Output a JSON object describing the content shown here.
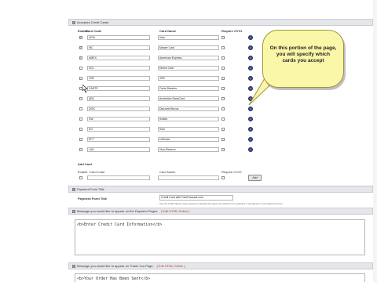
{
  "accepted_section": {
    "title": "Accepted Credit Cards"
  },
  "columns": {
    "enable": "Enable",
    "code": "Card Code",
    "name": "Card Name",
    "cvv": "Require CVV2"
  },
  "cards": [
    {
      "enabled": true,
      "code": "VISA",
      "name": "Visa"
    },
    {
      "enabled": true,
      "code": "MC",
      "name": "Master Card"
    },
    {
      "enabled": true,
      "code": "AMEX",
      "name": "American Express"
    },
    {
      "enabled": false,
      "code": "DCL",
      "name": "Diners Club"
    },
    {
      "enabled": false,
      "code": "JCB",
      "name": "JCB"
    },
    {
      "enabled": false,
      "code": "CARTE",
      "name": "Carte Blanche"
    },
    {
      "enabled": false,
      "code": "ABC",
      "name": "Australian BankCard"
    },
    {
      "enabled": false,
      "code": "DISC",
      "name": "Discover/Novus"
    },
    {
      "enabled": false,
      "code": "SW",
      "name": "Switch"
    },
    {
      "enabled": false,
      "code": "SO",
      "name": "Solo"
    },
    {
      "enabled": false,
      "code": "EFT",
      "name": "enRoute"
    },
    {
      "enabled": false,
      "code": "LAS",
      "name": "Visa Electron"
    }
  ],
  "add_card": {
    "title": "Add Card",
    "enable_label": "Enable",
    "code_label": "Card Code",
    "name_label": "Card Name",
    "cvv_label": "Require CVV2",
    "add_button": "Add"
  },
  "payment_form": {
    "section_title": "Payment Form Title",
    "label": "Payment Form Title",
    "value": "Credit Card with FastTransact.com",
    "help": "Use the HTML field to help customers identify this payment method if it is selected. It will appear on the Payment Form."
  },
  "payment_message": {
    "title": "Message you would like to appear on the Payment Pages:",
    "link": "[ Edit HTML Online ]",
    "value": "<b>Enter Credit Card Information</b>"
  },
  "thankyou_message": {
    "title": "Message you would like to appear on Thank You Page:",
    "link": "[ Edit HTML Online ]",
    "value": "<b>Your Order Has Been Sent</b>"
  },
  "callout": {
    "text": "On this portion of the page, you will specify which cards you accept"
  },
  "colors": {
    "callout_bg": "#fbf7a8",
    "section_bg": "#e4e6ea",
    "link": "#c0392b",
    "delete_icon": "#3a4a8c"
  }
}
